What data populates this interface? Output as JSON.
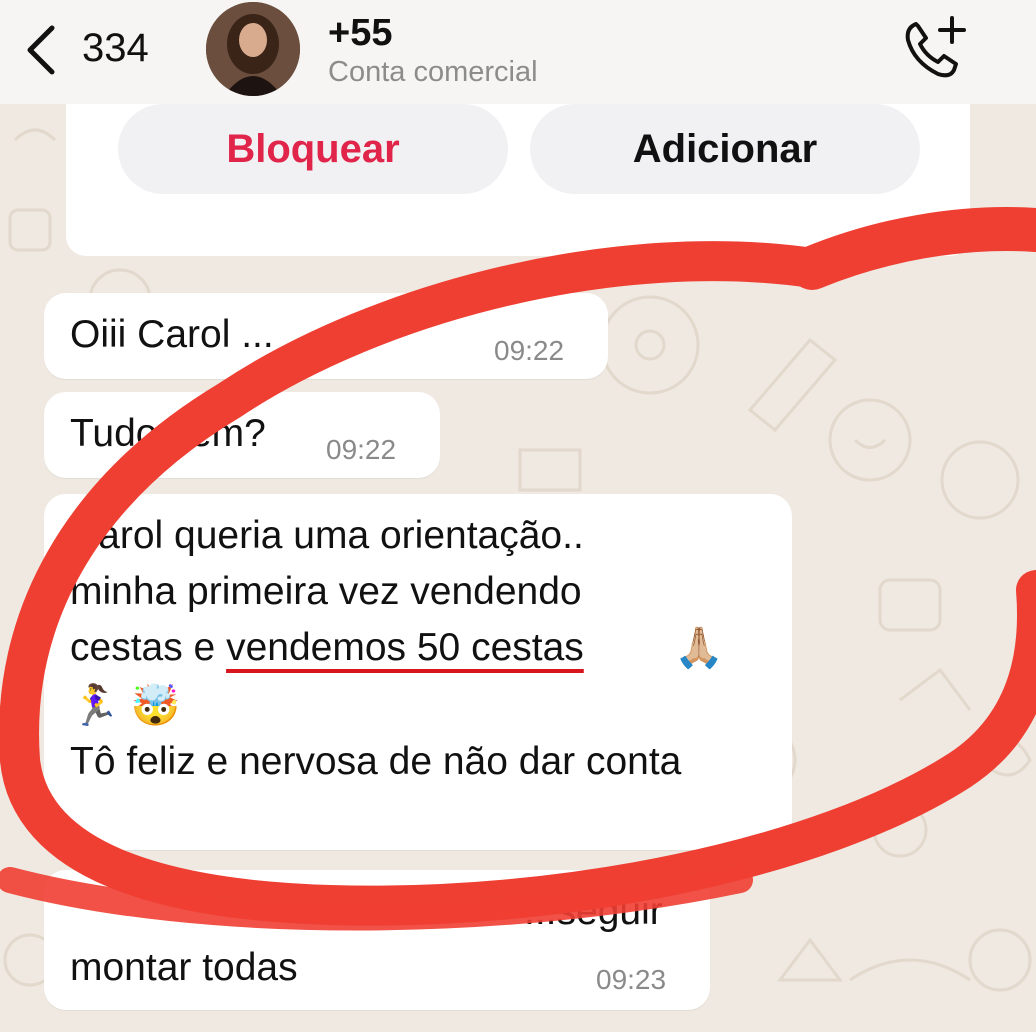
{
  "header": {
    "back_count": "334",
    "contact_name": "+55",
    "contact_subtitle": "Conta comercial",
    "icons": {
      "back": "chevron-left-icon",
      "call": "phone-add-icon"
    }
  },
  "actions": {
    "block_label": "Bloquear",
    "add_label": "Adicionar",
    "block_color": "#e0244a"
  },
  "messages": [
    {
      "text": "Oiii Carol ...",
      "time": "09:22"
    },
    {
      "text": "Tudo bem?",
      "time": "09:22"
    },
    {
      "line1": "Carol queria uma orientação..",
      "line2": "minha primeira vez vendendo",
      "line3_start": "cestas e ",
      "line3_highlight": "vendemos 50 cestas",
      "emoji1": "🙏🏼",
      "emoji2": "🏃‍♀️ 🤯",
      "line5": "Tô feliz e nervosa de não dar conta",
      "time": ""
    },
    {
      "text_partial": "...seguir",
      "text_line2": "montar todas",
      "time": "09:23"
    }
  ],
  "colors": {
    "wallpaper": "#efe9e1",
    "bubble": "#ffffff",
    "annotation_red": "#ef3e32",
    "underline_red": "#d8141d"
  }
}
